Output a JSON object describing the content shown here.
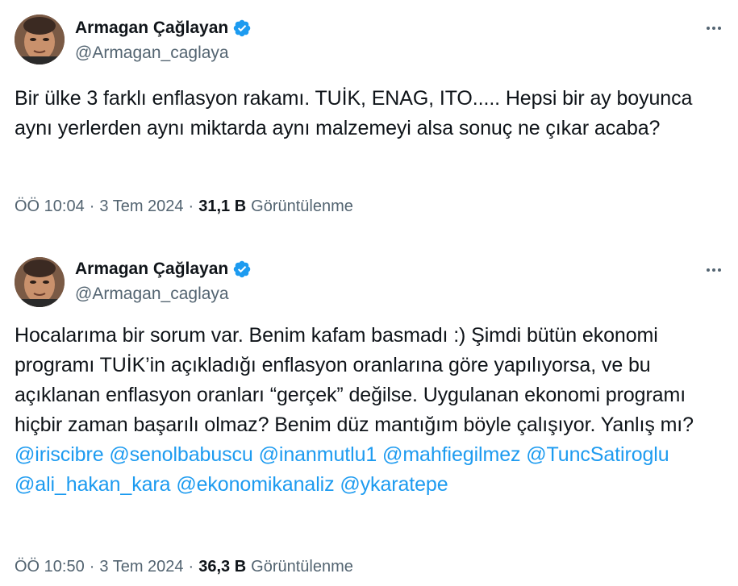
{
  "tweets": [
    {
      "author_name": "Armagan Çağlayan",
      "handle": "@Armagan_caglaya",
      "verified": true,
      "text": "Bir ülke 3 farklı enflasyon rakamı. TUİK, ENAG, ITO..... Hepsi bir ay boyunca aynı yerlerden aynı miktarda aynı malzemeyi alsa sonuç ne çıkar acaba?",
      "time": "ÖÖ 10:04",
      "date": "3 Tem 2024",
      "views_count": "31,1 B",
      "views_label": "Görüntülenme"
    },
    {
      "author_name": "Armagan Çağlayan",
      "handle": "@Armagan_caglaya",
      "verified": true,
      "text": "Hocalarıma bir sorum var. Benim kafam basmadı :) Şimdi bütün ekonomi programı TUİK’in açıkladığı enflasyon oranlarına göre yapılıyorsa, ve bu açıklanan enflasyon oranları “gerçek” değilse. Uygulanan ekonomi programı hiçbir zaman başarılı olmaz? Benim düz mantığım böyle çalışıyor. Yanlış mı?",
      "mentions": [
        "@iriscibre",
        "@senolbabuscu",
        "@inanmutlu1",
        "@mahfiegilmez",
        "@TuncSatiroglu",
        "@ali_hakan_kara",
        "@ekonomikanaliz",
        "@ykaratepe"
      ],
      "time": "ÖÖ 10:50",
      "date": "3 Tem 2024",
      "views_count": "36,3 B",
      "views_label": "Görüntülenme"
    }
  ],
  "separator": "·",
  "icons": {
    "verified": "verified-badge-icon",
    "more": "more-options-icon",
    "avatar": "avatar"
  },
  "colors": {
    "text": "#0f1419",
    "secondary": "#536471",
    "link": "#1d9bf0",
    "verified": "#1d9bf0"
  }
}
